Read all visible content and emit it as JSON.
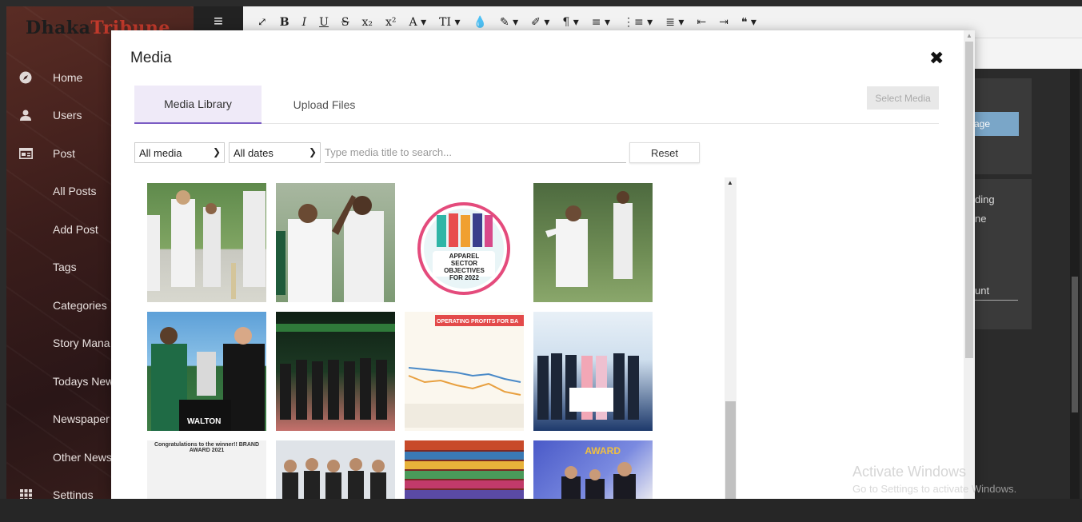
{
  "sidebar": {
    "logo": {
      "part1": "Dhaka",
      "part2": "Tribune"
    },
    "items": [
      {
        "label": "Home",
        "icon": "compass-icon"
      },
      {
        "label": "Users",
        "icon": "user-icon"
      },
      {
        "label": "Post",
        "icon": "post-icon"
      },
      {
        "label": "All Posts"
      },
      {
        "label": "Add Post"
      },
      {
        "label": "Tags"
      },
      {
        "label": "Categories"
      },
      {
        "label": "Story Mana"
      },
      {
        "label": "Todays New"
      },
      {
        "label": "Newspaper"
      },
      {
        "label": "Other News"
      },
      {
        "label": "Settings",
        "icon": "grid-icon"
      }
    ]
  },
  "toolbar": {
    "buttons": [
      "⤢",
      "B",
      "I",
      "U",
      "S",
      "x₂",
      "x²",
      "A ▾",
      "TI ▾",
      "💧",
      "✎ ▾",
      "✐ ▾",
      "¶ ▾",
      "≡ ▾",
      "⋮≡ ▾",
      "≣ ▾",
      "⇤",
      "⇥",
      "❝ ▾"
    ]
  },
  "background": {
    "button_text": "age",
    "text1": "ding",
    "text2": "ne",
    "text3": "unt"
  },
  "modal": {
    "title": "Media",
    "close": "✖",
    "tabs": [
      "Media Library",
      "Upload Files"
    ],
    "select_media_label": "Select Media",
    "filters": {
      "media_type": "All media",
      "dates": "All dates",
      "search_placeholder": "Type media title to search...",
      "reset_label": "Reset"
    },
    "images": [
      {
        "caption": "",
        "center_text": "",
        "kind": "cricket1"
      },
      {
        "caption": "",
        "center_text": "",
        "kind": "cricket2"
      },
      {
        "caption": "",
        "center_text": "APPAREL SECTOR OBJECTIVES FOR 2022",
        "kind": "infographic"
      },
      {
        "caption": "",
        "center_text": "",
        "kind": "cricket3"
      },
      {
        "caption": "WALTON",
        "center_text": "",
        "kind": "trophy"
      },
      {
        "caption": "",
        "center_text": "",
        "kind": "event"
      },
      {
        "caption": "",
        "center_text": "OPERATING PROFITS FOR BA",
        "kind": "chart"
      },
      {
        "caption": "",
        "center_text": "",
        "kind": "stage"
      },
      {
        "caption": "",
        "center_text": "Congratulations to the winner!! BRAND AWARD 2021",
        "kind": "brand"
      },
      {
        "caption": "",
        "center_text": "",
        "kind": "group"
      },
      {
        "caption": "",
        "center_text": "",
        "kind": "fabric"
      },
      {
        "caption": "",
        "center_text": "AWARD",
        "kind": "award"
      }
    ]
  },
  "watermark": {
    "line1": "Activate Windows",
    "line2": "Go to Settings to activate Windows."
  }
}
